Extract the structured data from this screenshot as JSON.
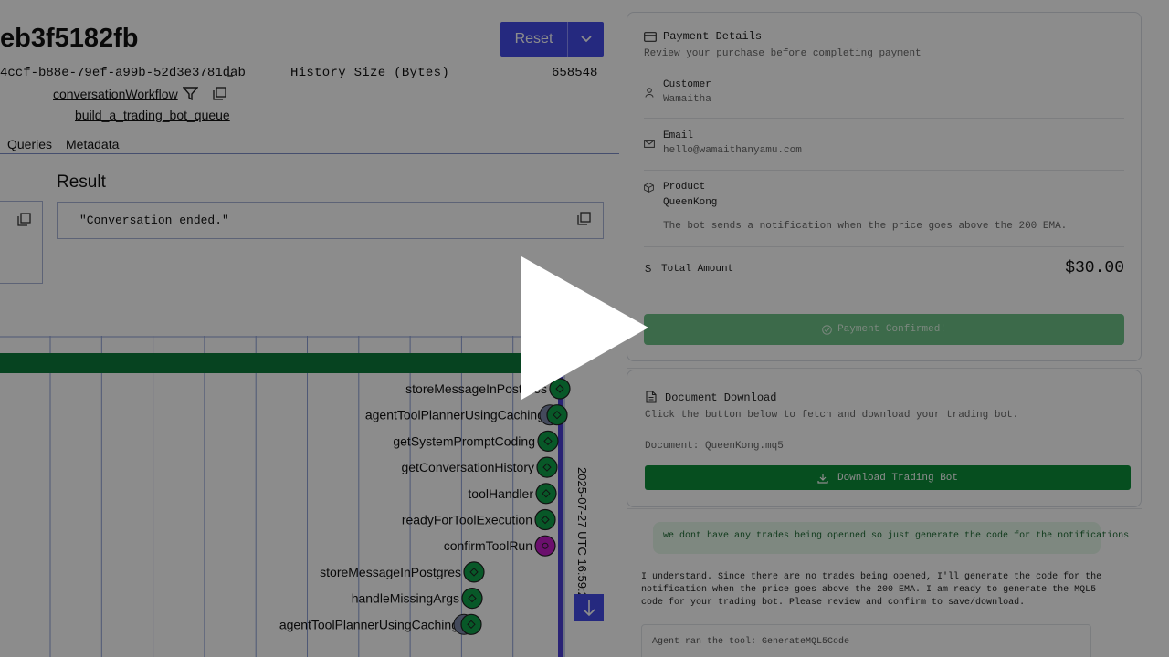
{
  "workflow": {
    "title_fragment": "eb3f5182fb",
    "run_id_fragment": "4ccf-b88e-79ef-a99b-52d3e3781dab",
    "history_size_label": "History Size (Bytes)",
    "history_size_value": "658548",
    "workflow_type": "conversationWorkflow",
    "task_queue": "build_a_trading_bot_queue",
    "reset_label": "Reset",
    "tabs": [
      "Queries",
      "Metadata"
    ],
    "result_heading": "Result",
    "result_value": "\"Conversation ended.\""
  },
  "timeline": {
    "date_label": "2025-07-27 UTC 16:59:2",
    "events": [
      {
        "name": "storeMessageInPostgres",
        "status": "completed"
      },
      {
        "name": "agentToolPlannerUsingCaching",
        "status": "completed"
      },
      {
        "name": "getSystemPromptCoding",
        "status": "completed"
      },
      {
        "name": "getConversationHistory",
        "status": "completed"
      },
      {
        "name": "toolHandler",
        "status": "completed"
      },
      {
        "name": "readyForToolExecution",
        "status": "completed"
      },
      {
        "name": "confirmToolRun",
        "status": "signal"
      },
      {
        "name": "storeMessageInPostgres",
        "status": "completed"
      },
      {
        "name": "handleMissingArgs",
        "status": "completed"
      },
      {
        "name": "agentToolPlannerUsingCaching",
        "status": "completed"
      }
    ]
  },
  "payment": {
    "title": "Payment Details",
    "subtitle": "Review your purchase before completing payment",
    "customer_label": "Customer",
    "customer_value": "Wamaitha",
    "email_label": "Email",
    "email_value": "hello@wamaithanyamu.com",
    "product_label": "Product",
    "product_value": "QueenKong",
    "product_description": "The bot sends a notification when the price goes above the 200 EMA.",
    "total_label": "Total Amount",
    "total_value": "$30.00",
    "confirmed_label": "Payment Confirmed!"
  },
  "document": {
    "title": "Document Download",
    "subtitle": "Click the button below to fetch and download your trading bot.",
    "file_line": "Document: QueenKong.mq5",
    "download_label": "Download Trading Bot"
  },
  "chat": {
    "user_message": "we dont have any trades being openned so just generate the code for the notifications",
    "agent_message": "I understand. Since there are no trades being opened, I'll generate the code for the notification when the price goes above the 200 EMA. I am ready to generate the MQL5 code for your trading bot. Please review and confirm to save/download.",
    "tool_note": "Agent ran the tool: GenerateMQL5Code"
  },
  "colors": {
    "accent": "#444ce7",
    "bar_green": "#0b7a3b",
    "event_green": "#0fa14a",
    "signal_purple": "#c41cc7",
    "timeline_blue": "#4b3fd6",
    "download_green": "#0b8e3a",
    "overlay": "rgba(0,0,0,0.45)"
  }
}
